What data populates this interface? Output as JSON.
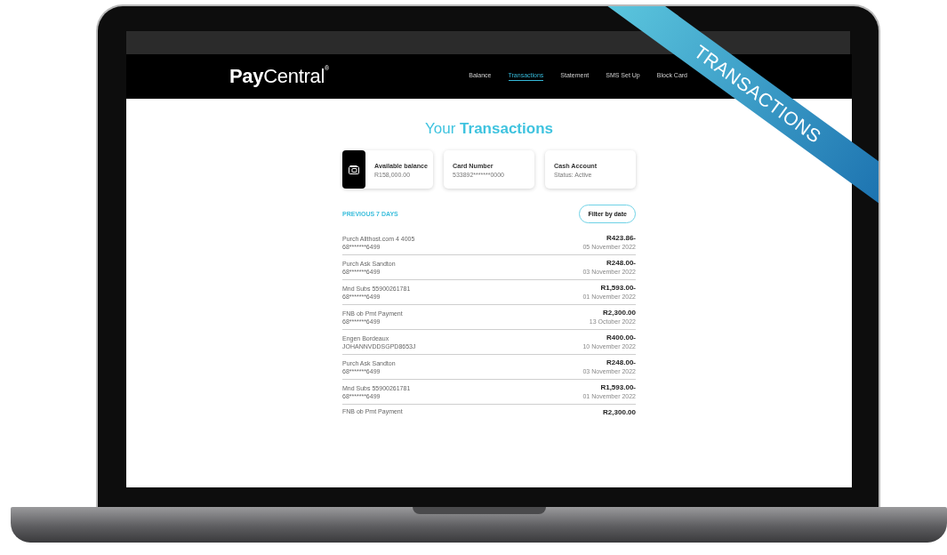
{
  "ribbon": {
    "label": "TRANSACTIONS"
  },
  "brand": {
    "logo": "**Pay**Central$^{®}$"
  },
  "nav": [
    {
      "label": "Balance",
      "selected": false
    },
    {
      "label": "Transactions",
      "selected": true
    },
    {
      "label": "Statement",
      "selected": false
    },
    {
      "label": "SMS Set Up",
      "selected": false
    },
    {
      "label": "Block Card",
      "selected": false
    }
  ],
  "title": "Your **Transactions**",
  "cards": [
    {
      "kind": "balance",
      "title": "Available balance",
      "value": "R158,000.00"
    },
    {
      "kind": "plain",
      "title": "Card Number",
      "value": "533892*******0000"
    },
    {
      "kind": "plain",
      "title": "Cash Account",
      "value": "Status: Active"
    }
  ],
  "section": {
    "label": "PREVIOUS 7 DAYS",
    "filter_button": "Filter by date"
  },
  "transactions": [
    {
      "description": "Purch Allthost.com 4 4005",
      "account": "68*******6499",
      "amount": "R423.86-",
      "date": "05 November 2022"
    },
    {
      "description": "Purch Ask Sandton",
      "account": "68*******6499",
      "amount": "R248.00-",
      "date": "03 November 2022"
    },
    {
      "description": "Mnd Subs 55900261781",
      "account": "68*******6499",
      "amount": "R1,593.00-",
      "date": "01 November 2022"
    },
    {
      "description": "FNB ob Pmt Payment",
      "account": "68*******6499",
      "amount": "R2,300.00",
      "date": "13 October 2022"
    },
    {
      "description": "Engen Bordeaux",
      "account": "JOHANNVDDSGPD8653J",
      "amount": "R400.00-",
      "date": "10 November 2022"
    },
    {
      "description": "Purch Ask Sandton",
      "account": "68*******6499",
      "amount": "R248.00-",
      "date": "03 November 2022"
    },
    {
      "description": "Mnd Subs 55900261781",
      "account": "68*******6499",
      "amount": "R1,593.00-",
      "date": "01 November 2022"
    },
    {
      "description": "FNB ob Pmt Payment",
      "amount": "R2,300.00"
    }
  ]
}
